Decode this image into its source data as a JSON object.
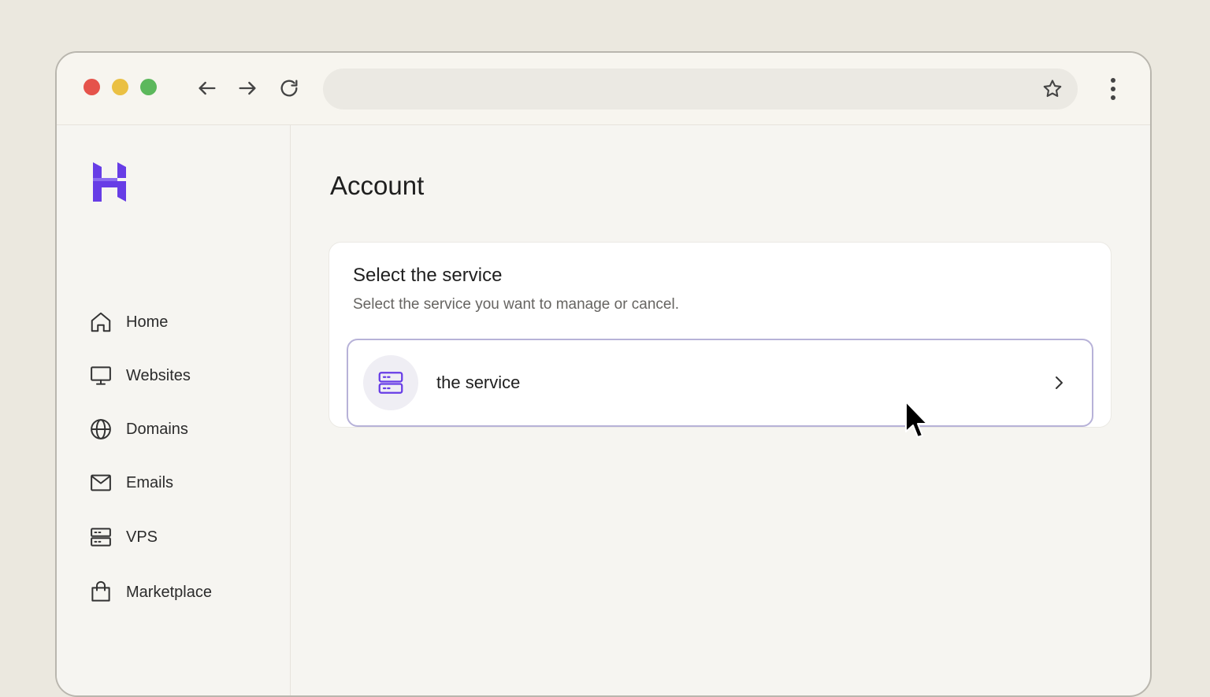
{
  "browser": {
    "nav_buttons": [
      "back-arrow-icon",
      "forward-arrow-icon",
      "reload-icon"
    ],
    "address_bar": {
      "value": ""
    },
    "icons": [
      "star-icon",
      "kebab-menu-icon"
    ]
  },
  "sidebar": {
    "logo": "hostinger-logo",
    "items": [
      {
        "label": "Home",
        "icon": "home-icon"
      },
      {
        "label": "Websites",
        "icon": "monitor-icon"
      },
      {
        "label": "Domains",
        "icon": "globe-icon"
      },
      {
        "label": "Emails",
        "icon": "mail-icon"
      },
      {
        "label": "VPS",
        "icon": "server-icon"
      },
      {
        "label": "Marketplace",
        "icon": "shopping-bag-icon"
      }
    ]
  },
  "main": {
    "title": "Account",
    "card": {
      "title": "Select the service",
      "subtitle": "Select the service you want to manage or cancel.",
      "service": {
        "label": "the service",
        "icon": "server-icon"
      }
    }
  },
  "colors": {
    "accent": "#673de6",
    "row_border": "#b7b2d8",
    "background": "#ebe8df"
  }
}
